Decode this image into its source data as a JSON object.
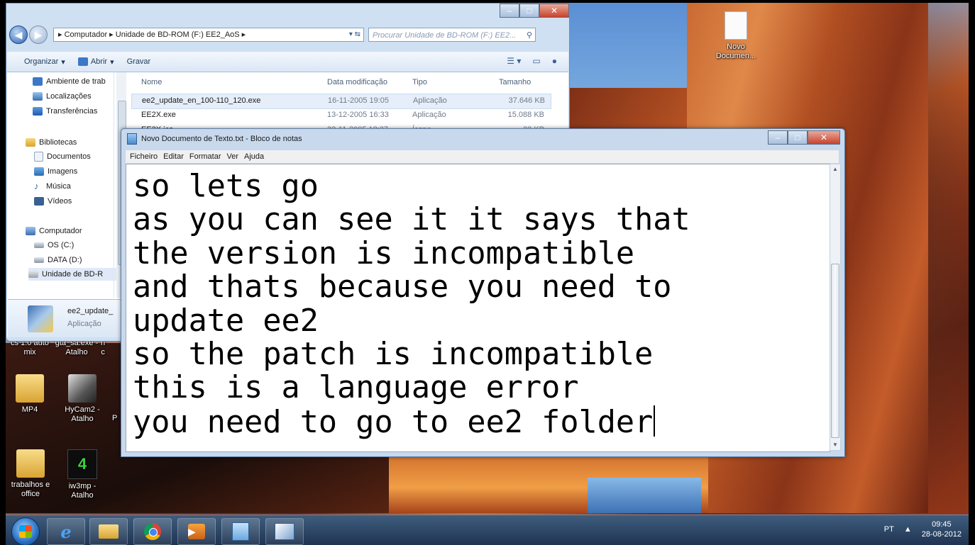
{
  "explorer": {
    "address": {
      "segments": [
        "Computador",
        "Unidade de BD-ROM (F:) EE2_AoS"
      ],
      "search_placeholder": "Procurar Unidade de BD-ROM (F:) EE2..."
    },
    "toolbar": {
      "organize": "Organizar",
      "open": "Abrir",
      "burn": "Gravar"
    },
    "nav_pane": [
      {
        "label": "Ambiente de trab",
        "icon": "desktop-icon"
      },
      {
        "label": "Localizações",
        "icon": "places-icon"
      },
      {
        "label": "Transferências",
        "icon": "downloads-icon"
      },
      {
        "label": "Bibliotecas",
        "icon": "libraries-icon"
      },
      {
        "label": "Documentos",
        "icon": "documents-icon"
      },
      {
        "label": "Imagens",
        "icon": "pictures-icon"
      },
      {
        "label": "Música",
        "icon": "music-icon"
      },
      {
        "label": "Vídeos",
        "icon": "videos-icon"
      },
      {
        "label": "Computador",
        "icon": "computer-icon"
      },
      {
        "label": "OS (C:)",
        "icon": "drive-icon"
      },
      {
        "label": "DATA (D:)",
        "icon": "drive-icon"
      },
      {
        "label": "Unidade de BD-R",
        "icon": "bd-drive-icon"
      }
    ],
    "columns": [
      "Nome",
      "Data modificação",
      "Tipo",
      "Tamanho"
    ],
    "files": [
      {
        "name": "ee2_update_en_100-110_120.exe",
        "date": "16-11-2005 19:05",
        "type": "Aplicação",
        "size": "37.646 KB"
      },
      {
        "name": "EE2X.exe",
        "date": "13-12-2005 16:33",
        "type": "Aplicação",
        "size": "15.088 KB"
      },
      {
        "name": "EE2X.ico",
        "date": "22-11-2005 18:37",
        "type": "Ícone",
        "size": "22 KB"
      }
    ],
    "details": {
      "name": "ee2_update_",
      "type": "Aplicação"
    }
  },
  "notepad": {
    "title": "Novo Documento de Texto.txt - Bloco de notas",
    "menu": [
      "Ficheiro",
      "Editar",
      "Formatar",
      "Ver",
      "Ajuda"
    ],
    "lines": [
      "so lets go",
      "as you can see it it says that",
      "the version is incompatible",
      "and thats because you need to",
      "update ee2",
      "so the patch is incompatible",
      "this is a language error",
      "you need to go to ee2 folder"
    ]
  },
  "desktop_icons": [
    {
      "label": "Novo Documen...",
      "icon": "text-file-icon"
    },
    {
      "label": "cs 1.0 auto mix",
      "icon": "shortcut-icon"
    },
    {
      "label": "gta_sa.exe - Atalho",
      "icon": "shortcut-icon"
    },
    {
      "label": "MP4",
      "icon": "folder-icon"
    },
    {
      "label": "HyCam2 - Atalho",
      "icon": "camera-icon"
    },
    {
      "label": "trabalhos e office",
      "icon": "folder-icon"
    },
    {
      "label": "iw3mp - Atalho",
      "icon": "cod4-icon"
    }
  ],
  "partial_icon_letters": {
    "p": "P",
    "n": "n",
    "c": "c"
  },
  "taskbar": {
    "apps": [
      "internet-explorer-icon",
      "file-explorer-icon",
      "chrome-icon",
      "media-player-icon",
      "notepad-icon",
      "hycam-icon"
    ],
    "lang": "PT",
    "tray_arrow": "▲",
    "time": "09:45",
    "date": "28-08-2012"
  },
  "colors": {
    "taskbar": "#1e3350",
    "window_frame": "#c8d9ee",
    "selection": "#e5eef9"
  }
}
